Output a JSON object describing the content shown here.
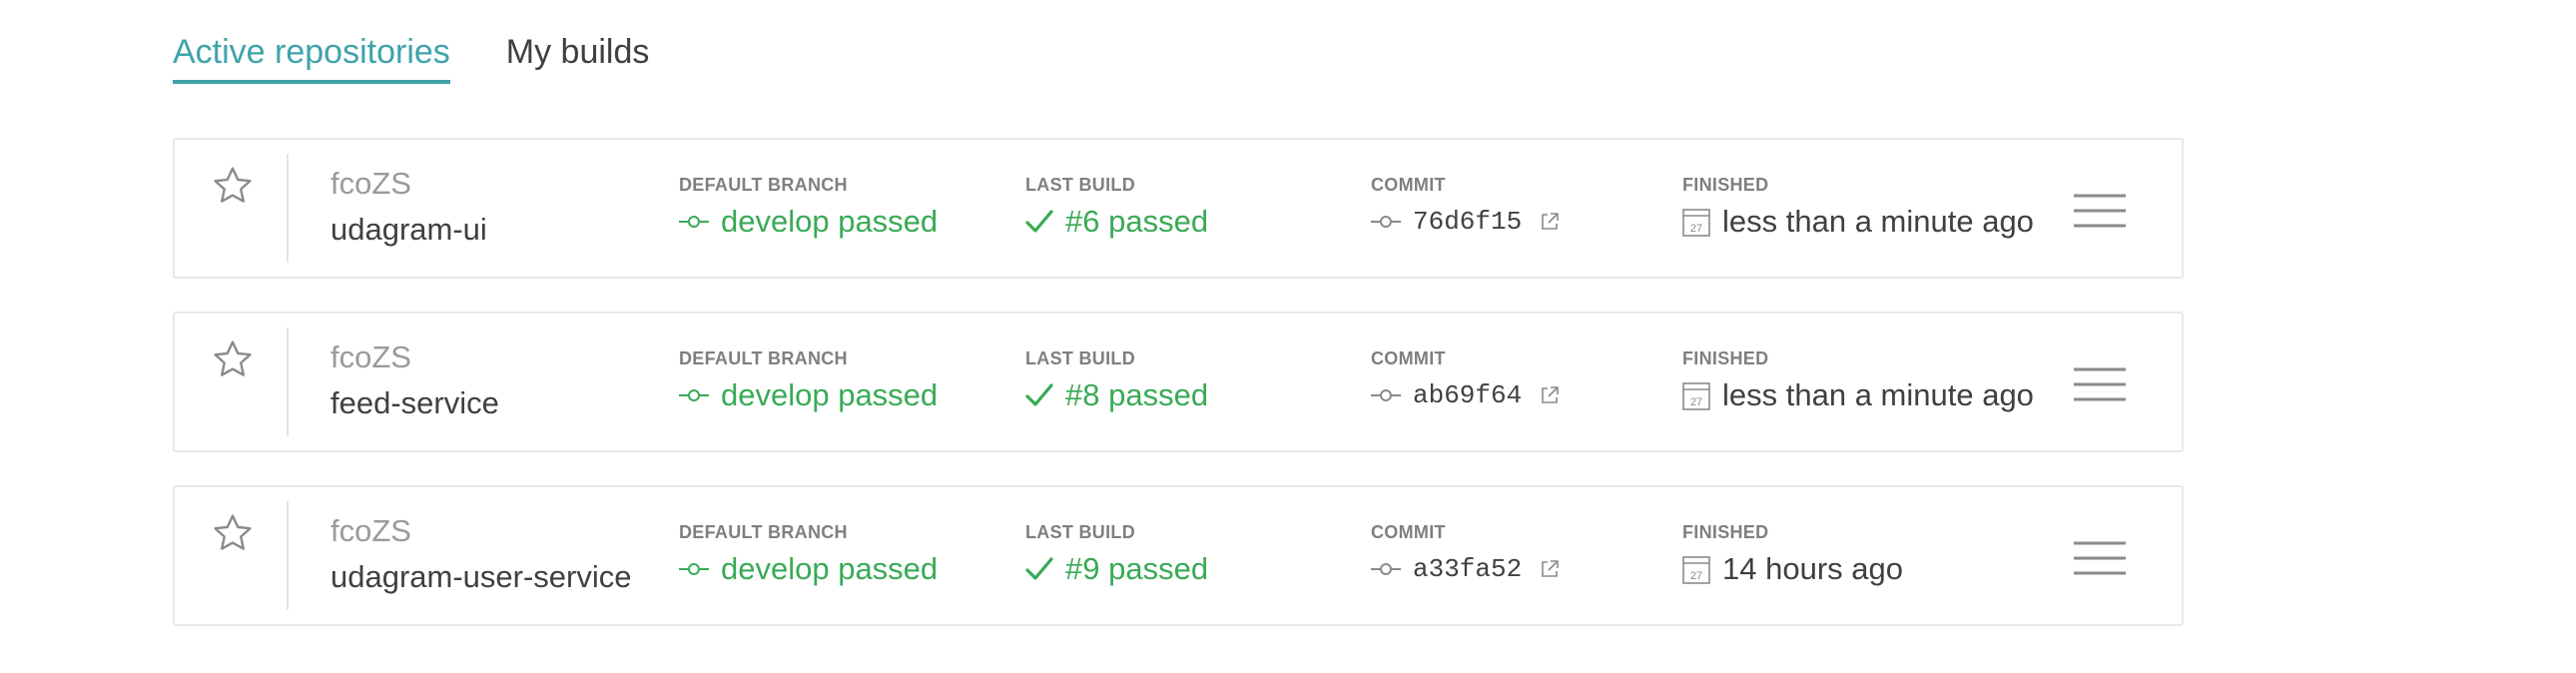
{
  "tabs": [
    {
      "label": "Active repositories",
      "active": true
    },
    {
      "label": "My builds",
      "active": false
    }
  ],
  "labels": {
    "default_branch": "DEFAULT BRANCH",
    "last_build": "LAST BUILD",
    "commit": "COMMIT",
    "finished": "FINISHED"
  },
  "calendar_day": "27",
  "colors": {
    "accent": "#3fa3aa",
    "passed": "#39aa56",
    "muted": "#9a9a9a"
  },
  "repositories": [
    {
      "owner": "fcoZS",
      "name": "udagram-ui",
      "branch_status": "develop passed",
      "build_status": "#6 passed",
      "commit": "76d6f15",
      "finished": "less than a minute ago"
    },
    {
      "owner": "fcoZS",
      "name": "feed-service",
      "branch_status": "develop passed",
      "build_status": "#8 passed",
      "commit": "ab69f64",
      "finished": "less than a minute ago"
    },
    {
      "owner": "fcoZS",
      "name": "udagram-user-service",
      "branch_status": "develop passed",
      "build_status": "#9 passed",
      "commit": "a33fa52",
      "finished": "14 hours ago"
    }
  ]
}
